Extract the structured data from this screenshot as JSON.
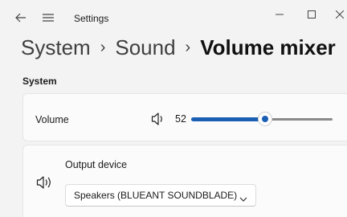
{
  "window": {
    "title": "Settings",
    "icons": {
      "back": "back-arrow-icon",
      "menu": "hamburger-menu-icon",
      "minimize": "minimize-icon",
      "maximize": "maximize-icon",
      "close": "close-icon"
    }
  },
  "breadcrumb": {
    "items": [
      "System",
      "Sound"
    ],
    "separator": "›",
    "current": "Volume mixer"
  },
  "system_section": {
    "heading": "System",
    "volume": {
      "label": "Volume",
      "value": "52",
      "level": 52,
      "icon": "speaker-icon"
    },
    "output_device": {
      "label": "Output device",
      "selected": "Speakers (BLUEANT SOUNDBLADE)",
      "icon": "speaker-icon"
    }
  },
  "colors": {
    "accent": "#1a5fb4",
    "background": "#f3f3f3",
    "card": "#fbfbfb"
  }
}
